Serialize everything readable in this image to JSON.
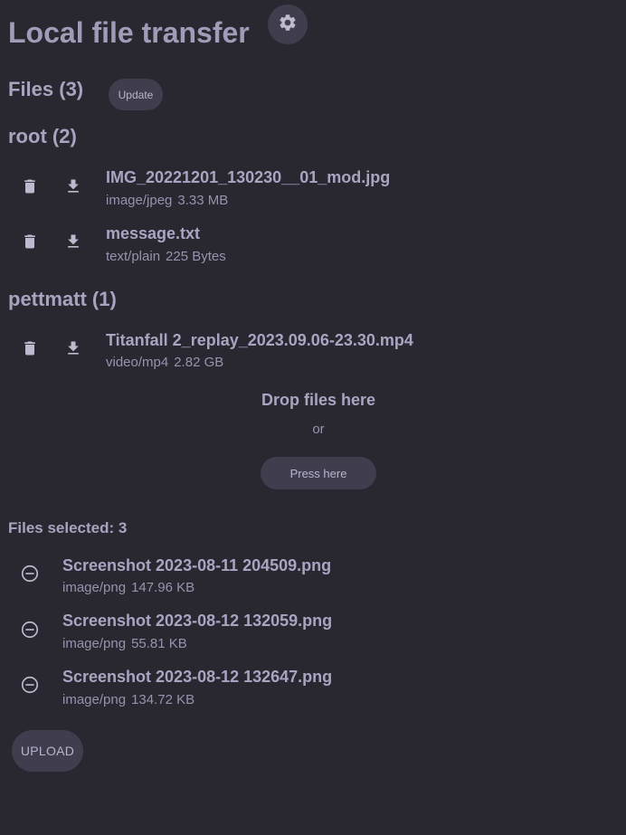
{
  "header": {
    "title": "Local file transfer",
    "settings_icon": "gear-icon"
  },
  "files": {
    "heading": "Files (3)",
    "update_label": "Update",
    "groups": [
      {
        "heading": "root (2)",
        "items": [
          {
            "name": "IMG_20221201_130230__01_mod.jpg",
            "type": "image/jpeg",
            "size": "3.33 MB"
          },
          {
            "name": "message.txt",
            "type": "text/plain",
            "size": "225 Bytes"
          }
        ]
      },
      {
        "heading": "pettmatt (1)",
        "items": [
          {
            "name": "Titanfall 2_replay_2023.09.06-23.30.mp4",
            "type": "video/mp4",
            "size": "2.82 GB"
          }
        ]
      }
    ]
  },
  "dropzone": {
    "title": "Drop files here",
    "or": "or",
    "press_label": "Press here"
  },
  "selected": {
    "label": "Files selected: 3",
    "items": [
      {
        "name": "Screenshot 2023-08-11 204509.png",
        "type": "image/png",
        "size": "147.96 KB"
      },
      {
        "name": "Screenshot 2023-08-12 132059.png",
        "type": "image/png",
        "size": "55.81 KB"
      },
      {
        "name": "Screenshot 2023-08-12 132647.png",
        "type": "image/png",
        "size": "134.72 KB"
      }
    ],
    "upload_label": "UPLOAD"
  },
  "colors": {
    "background": "#292831",
    "button": "#403e4e",
    "text": "#a6a3bd"
  }
}
